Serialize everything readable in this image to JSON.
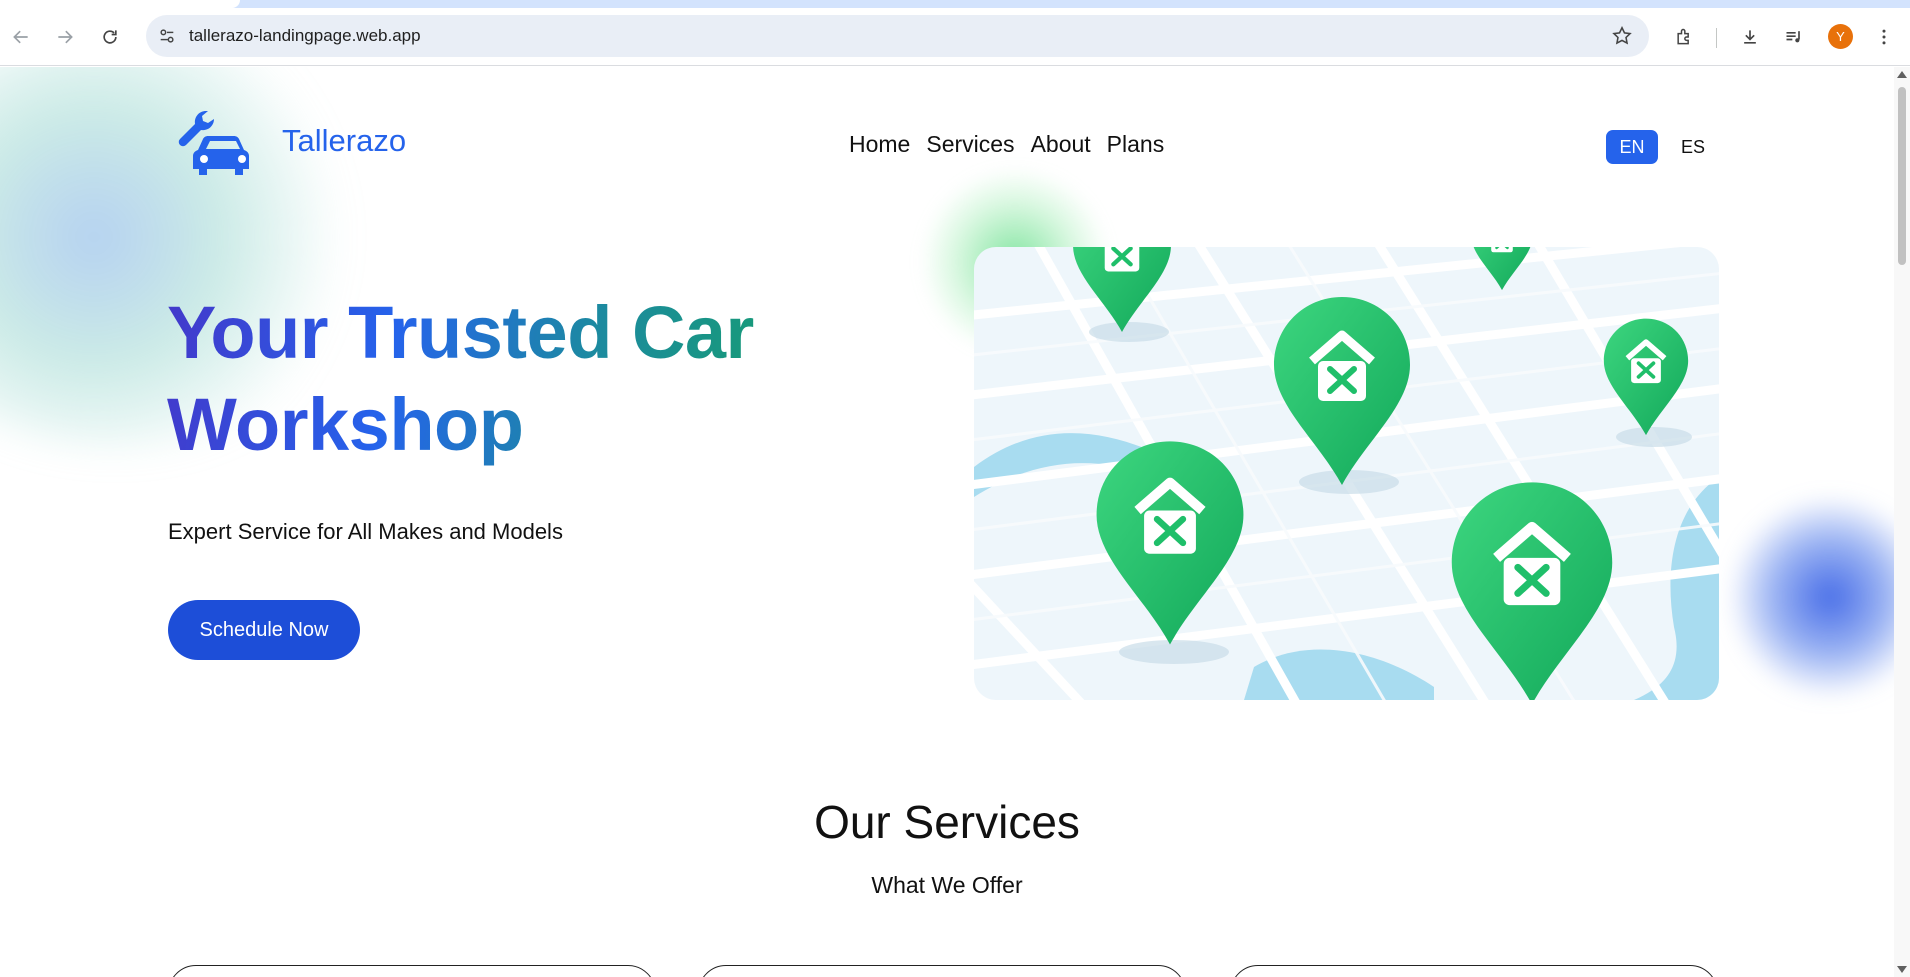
{
  "browser": {
    "url": "tallerazo-landingpage.web.app",
    "profile_initial": "Y",
    "icons": [
      "back-arrow-icon",
      "forward-arrow-icon",
      "reload-icon",
      "site-info-icon",
      "star-icon",
      "extensions-icon",
      "download-icon",
      "media-control-icon",
      "menu-icon"
    ]
  },
  "header": {
    "brand": "Tallerazo",
    "nav": [
      "Home",
      "Services",
      "About",
      "Plans"
    ],
    "lang_active": "EN",
    "lang_other": "ES"
  },
  "hero": {
    "title_line1": "Your Trusted Car",
    "title_line2": "Workshop",
    "subtitle": "Expert Service for All Makes and Models",
    "cta": "Schedule Now"
  },
  "services": {
    "title": "Our Services",
    "subtitle": "What We Offer"
  },
  "colors": {
    "brand_blue": "#2563eb",
    "cta_blue": "#1d4ed8",
    "pin_green": "#1fbf6a",
    "map_water": "#a8dcf0",
    "profile_orange": "#e8710a"
  }
}
